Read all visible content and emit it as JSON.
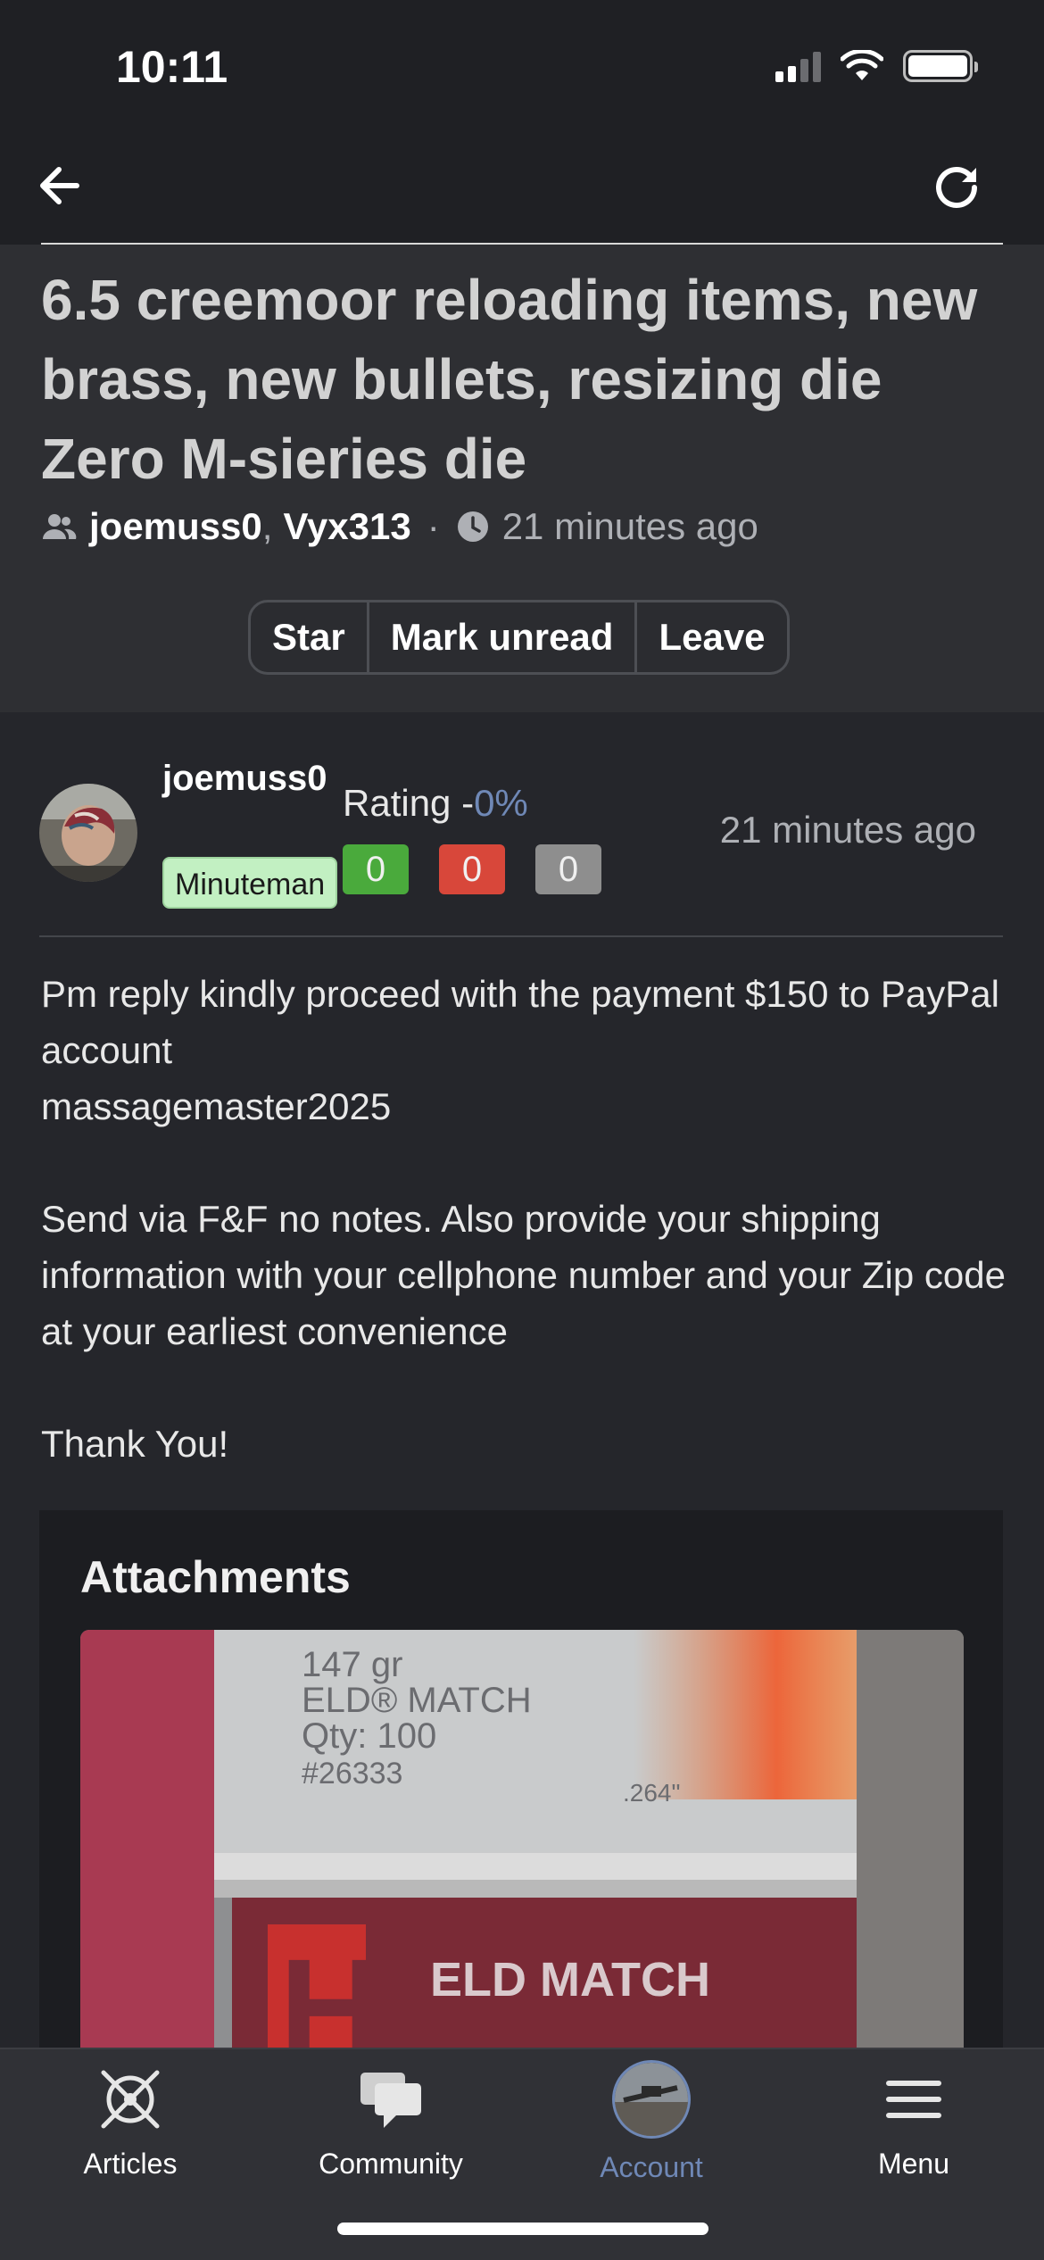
{
  "status_bar": {
    "time": "10:11"
  },
  "thread": {
    "title": "6.5 creemoor reloading items, new brass, new bullets, resizing die Zero M-sieries die",
    "participants": [
      "joemuss0",
      "Vyx313"
    ],
    "separator": ",",
    "meta_dot": "·",
    "time": "21 minutes ago",
    "actions": [
      "Star",
      "Mark unread",
      "Leave"
    ]
  },
  "post": {
    "username": "joemuss0",
    "badge": "Minuteman",
    "rating_label": "Rating -",
    "rating_pct": "0%",
    "rating_positive": "0",
    "rating_negative": "0",
    "rating_neutral": "0",
    "time": "21 minutes ago",
    "body": {
      "line1": "Pm reply kindly proceed with the payment $150 to PayPal account",
      "line2": "massagemaster2025",
      "para2": "Send via F&F no notes. Also provide your shipping information with your cellphone number and your Zip code at your earliest convenience",
      "para3": "Thank You!"
    },
    "attachments_title": "Attachments",
    "attachment_text": {
      "line1": "147 gr",
      "line2": "ELD® MATCH",
      "line3": "Qty: 100",
      "line4": "#26333",
      "caliber": ".264\"",
      "brand_letter": "H",
      "product": "ELD MATCH"
    }
  },
  "tab_bar": {
    "items": [
      {
        "label": "Articles",
        "icon": "articles-icon"
      },
      {
        "label": "Community",
        "icon": "chat-bubbles-icon"
      },
      {
        "label": "Account",
        "icon": "avatar"
      },
      {
        "label": "Menu",
        "icon": "hamburger-icon"
      }
    ],
    "active_index": 2,
    "active_color": "#6f88b6"
  },
  "colors": {
    "background": "#25262b",
    "header_background": "#2e2f33",
    "rating_positive": "#4aaa3c",
    "rating_negative": "#d8473a",
    "rating_neutral": "#8e8e8e",
    "badge_background": "#c2f0c2"
  }
}
